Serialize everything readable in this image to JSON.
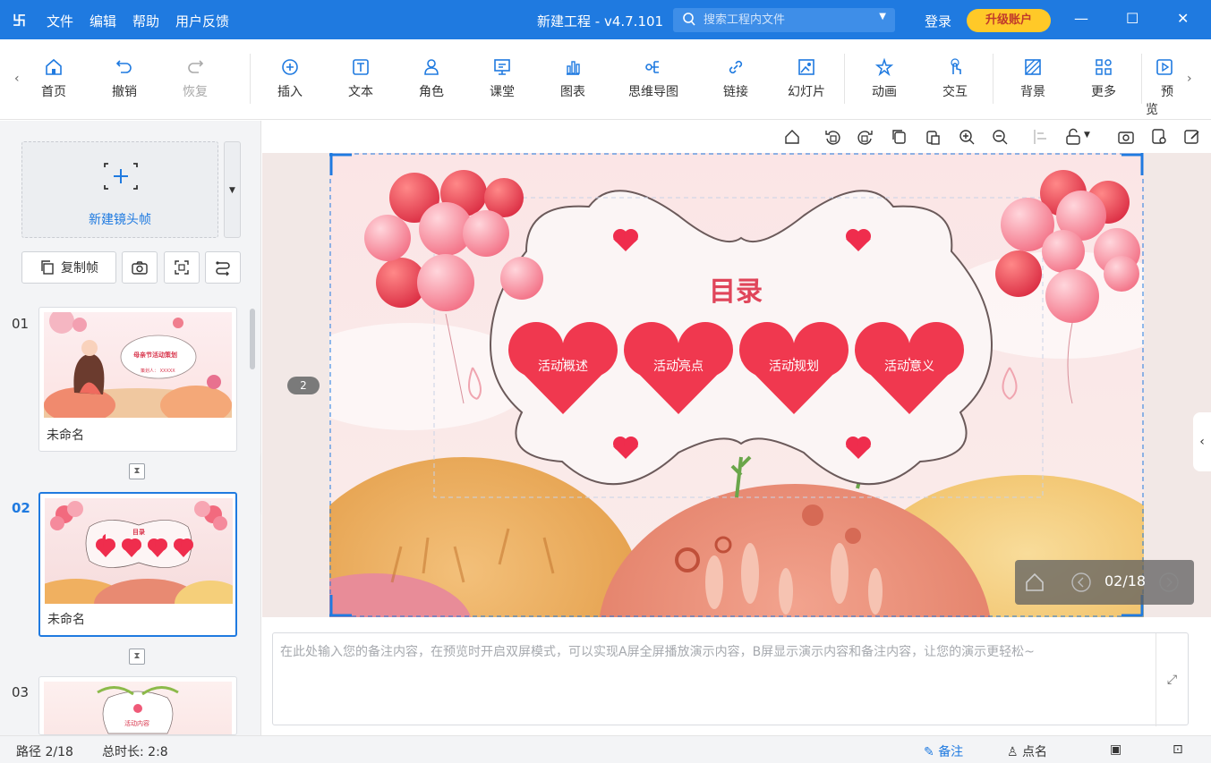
{
  "titlebar": {
    "logo": "卐",
    "menu": [
      "文件",
      "编辑",
      "帮助",
      "用户反馈"
    ],
    "title": "新建工程 - v4.7.101",
    "search_placeholder": "搜索工程内文件",
    "login": "登录",
    "upgrade": "升级账户"
  },
  "toolbar": {
    "items": [
      {
        "label": "首页",
        "icon": "home-icon"
      },
      {
        "label": "撤销",
        "icon": "undo-icon"
      },
      {
        "label": "恢复",
        "icon": "redo-icon"
      },
      {
        "label": "插入",
        "icon": "plus-circle-icon"
      },
      {
        "label": "文本",
        "icon": "text-icon"
      },
      {
        "label": "角色",
        "icon": "character-icon"
      },
      {
        "label": "课堂",
        "icon": "classroom-icon"
      },
      {
        "label": "图表",
        "icon": "chart-icon"
      },
      {
        "label": "思维导图",
        "icon": "mindmap-icon"
      },
      {
        "label": "链接",
        "icon": "link-icon"
      },
      {
        "label": "幻灯片",
        "icon": "slides-icon"
      },
      {
        "label": "动画",
        "icon": "animation-icon"
      },
      {
        "label": "交互",
        "icon": "interaction-icon"
      },
      {
        "label": "背景",
        "icon": "background-icon"
      },
      {
        "label": "更多",
        "icon": "more-icon"
      },
      {
        "label": "预览",
        "icon": "preview-icon"
      }
    ]
  },
  "left_panel": {
    "new_frame": "新建镜头帧",
    "copy_frame": "复制帧",
    "slides": [
      {
        "num": "01",
        "name": "未命名",
        "thumb_title": "母亲节活动策划",
        "thumb_sub": "策划人： XXXXX"
      },
      {
        "num": "02",
        "name": "未命名",
        "thumb_title": "目录"
      },
      {
        "num": "03",
        "name": "",
        "thumb_title": "活动内容"
      }
    ]
  },
  "slide": {
    "title": "目录",
    "hearts": [
      "活动概述",
      "活动亮点",
      "活动规划",
      "活动意义"
    ]
  },
  "stage": {
    "page_pill": "2",
    "nav_counter": "02/18"
  },
  "notes": {
    "placeholder": "在此处输入您的备注内容，在预览时开启双屏模式，可以实现A屏全屏播放演示内容，B屏显示演示内容和备注内容，让您的演示更轻松~"
  },
  "status": {
    "path": "路径 2/18",
    "duration": "总时长: 2:8",
    "notes": "备注",
    "rollcall": "点名"
  },
  "colors": {
    "accent": "#1f7ae0",
    "heart": "#f0384f",
    "upgrade": "#ffc928"
  }
}
